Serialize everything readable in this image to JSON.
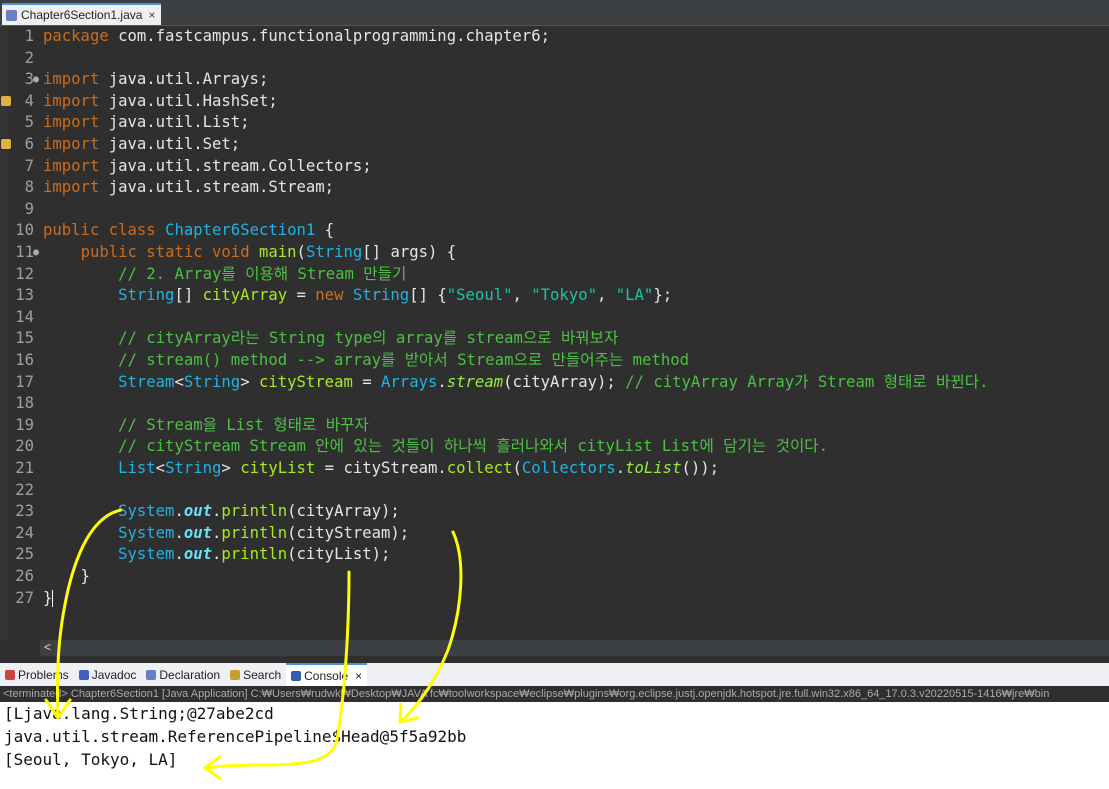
{
  "editor_tab": {
    "label": "Chapter6Section1.java",
    "close": "×"
  },
  "code_lines": [
    {
      "n": "1",
      "tokens": [
        {
          "c": "kw",
          "t": "package"
        },
        {
          "c": "",
          "t": " com.fastcampus.functionalprogramming.chapter6;"
        }
      ]
    },
    {
      "n": "2",
      "tokens": []
    },
    {
      "n": "3",
      "fold": true,
      "tokens": [
        {
          "c": "kw",
          "t": "import"
        },
        {
          "c": "",
          "t": " java.util.Arrays;"
        }
      ]
    },
    {
      "n": "4",
      "warn": true,
      "tokens": [
        {
          "c": "kw",
          "t": "import"
        },
        {
          "c": "",
          "t": " java.util.HashSet;"
        }
      ]
    },
    {
      "n": "5",
      "tokens": [
        {
          "c": "kw",
          "t": "import"
        },
        {
          "c": "",
          "t": " java.util.List;"
        }
      ]
    },
    {
      "n": "6",
      "warn": true,
      "tokens": [
        {
          "c": "kw",
          "t": "import"
        },
        {
          "c": "",
          "t": " java.util.Set;"
        }
      ]
    },
    {
      "n": "7",
      "tokens": [
        {
          "c": "kw",
          "t": "import"
        },
        {
          "c": "",
          "t": " java.util.stream.Collectors;"
        }
      ]
    },
    {
      "n": "8",
      "tokens": [
        {
          "c": "kw",
          "t": "import"
        },
        {
          "c": "",
          "t": " java.util.stream.Stream;"
        }
      ]
    },
    {
      "n": "9",
      "tokens": []
    },
    {
      "n": "10",
      "tokens": [
        {
          "c": "kw",
          "t": "public"
        },
        {
          "c": "",
          "t": " "
        },
        {
          "c": "kw",
          "t": "class"
        },
        {
          "c": "",
          "t": " "
        },
        {
          "c": "type",
          "t": "Chapter6Section1"
        },
        {
          "c": "",
          "t": " {"
        }
      ]
    },
    {
      "n": "11",
      "fold": true,
      "tokens": [
        {
          "c": "",
          "t": "    "
        },
        {
          "c": "kw",
          "t": "public"
        },
        {
          "c": "",
          "t": " "
        },
        {
          "c": "kw",
          "t": "static"
        },
        {
          "c": "",
          "t": " "
        },
        {
          "c": "kw",
          "t": "void"
        },
        {
          "c": "",
          "t": " "
        },
        {
          "c": "meth",
          "t": "main"
        },
        {
          "c": "",
          "t": "("
        },
        {
          "c": "type",
          "t": "String"
        },
        {
          "c": "",
          "t": "[] args) {"
        }
      ]
    },
    {
      "n": "12",
      "tokens": [
        {
          "c": "",
          "t": "        "
        },
        {
          "c": "cmt",
          "t": "// 2. Array를 이용해 Stream 만들기"
        }
      ]
    },
    {
      "n": "13",
      "tokens": [
        {
          "c": "",
          "t": "        "
        },
        {
          "c": "type",
          "t": "String"
        },
        {
          "c": "",
          "t": "[] "
        },
        {
          "c": "meth",
          "t": "cityArray"
        },
        {
          "c": "",
          "t": " = "
        },
        {
          "c": "kw",
          "t": "new"
        },
        {
          "c": "",
          "t": " "
        },
        {
          "c": "type",
          "t": "String"
        },
        {
          "c": "",
          "t": "[] {"
        },
        {
          "c": "str",
          "t": "\"Seoul\""
        },
        {
          "c": "",
          "t": ", "
        },
        {
          "c": "str",
          "t": "\"Tokyo\""
        },
        {
          "c": "",
          "t": ", "
        },
        {
          "c": "str",
          "t": "\"LA\""
        },
        {
          "c": "",
          "t": "};"
        }
      ]
    },
    {
      "n": "14",
      "tokens": []
    },
    {
      "n": "15",
      "tokens": [
        {
          "c": "",
          "t": "        "
        },
        {
          "c": "cmt",
          "t": "// cityArray라는 String type의 array를 stream으로 바꿔보자"
        }
      ]
    },
    {
      "n": "16",
      "tokens": [
        {
          "c": "",
          "t": "        "
        },
        {
          "c": "cmt",
          "t": "// stream() method --> array를 받아서 Stream으로 만들어주는 method"
        }
      ]
    },
    {
      "n": "17",
      "tokens": [
        {
          "c": "",
          "t": "        "
        },
        {
          "c": "type",
          "t": "Stream"
        },
        {
          "c": "",
          "t": "<"
        },
        {
          "c": "type",
          "t": "String"
        },
        {
          "c": "",
          "t": "> "
        },
        {
          "c": "meth",
          "t": "cityStream"
        },
        {
          "c": "",
          "t": " = "
        },
        {
          "c": "type",
          "t": "Arrays"
        },
        {
          "c": "",
          "t": "."
        },
        {
          "c": "smeth",
          "t": "stream"
        },
        {
          "c": "",
          "t": "(cityArray); "
        },
        {
          "c": "cmt",
          "t": "// cityArray Array가 Stream 형태로 바뀐다."
        }
      ]
    },
    {
      "n": "18",
      "tokens": []
    },
    {
      "n": "19",
      "tokens": [
        {
          "c": "",
          "t": "        "
        },
        {
          "c": "cmt",
          "t": "// Stream을 List 형태로 바꾸자"
        }
      ]
    },
    {
      "n": "20",
      "tokens": [
        {
          "c": "",
          "t": "        "
        },
        {
          "c": "cmt",
          "t": "// cityStream Stream 안에 있는 것들이 하나씩 흘러나와서 cityList List에 담기는 것이다."
        }
      ]
    },
    {
      "n": "21",
      "tokens": [
        {
          "c": "",
          "t": "        "
        },
        {
          "c": "type",
          "t": "List"
        },
        {
          "c": "",
          "t": "<"
        },
        {
          "c": "type",
          "t": "String"
        },
        {
          "c": "",
          "t": "> "
        },
        {
          "c": "meth",
          "t": "cityList"
        },
        {
          "c": "",
          "t": " = cityStream."
        },
        {
          "c": "meth",
          "t": "collect"
        },
        {
          "c": "",
          "t": "("
        },
        {
          "c": "type",
          "t": "Collectors"
        },
        {
          "c": "",
          "t": "."
        },
        {
          "c": "smeth",
          "t": "toList"
        },
        {
          "c": "",
          "t": "());"
        }
      ]
    },
    {
      "n": "22",
      "tokens": []
    },
    {
      "n": "23",
      "tokens": [
        {
          "c": "",
          "t": "        "
        },
        {
          "c": "type",
          "t": "System"
        },
        {
          "c": "",
          "t": "."
        },
        {
          "c": "fld",
          "t": "out"
        },
        {
          "c": "",
          "t": "."
        },
        {
          "c": "meth",
          "t": "println"
        },
        {
          "c": "",
          "t": "(cityArray);"
        }
      ]
    },
    {
      "n": "24",
      "tokens": [
        {
          "c": "",
          "t": "        "
        },
        {
          "c": "type",
          "t": "System"
        },
        {
          "c": "",
          "t": "."
        },
        {
          "c": "fld",
          "t": "out"
        },
        {
          "c": "",
          "t": "."
        },
        {
          "c": "meth",
          "t": "println"
        },
        {
          "c": "",
          "t": "(cityStream);"
        }
      ]
    },
    {
      "n": "25",
      "tokens": [
        {
          "c": "",
          "t": "        "
        },
        {
          "c": "type",
          "t": "System"
        },
        {
          "c": "",
          "t": "."
        },
        {
          "c": "fld",
          "t": "out"
        },
        {
          "c": "",
          "t": "."
        },
        {
          "c": "meth",
          "t": "println"
        },
        {
          "c": "",
          "t": "(cityList);"
        }
      ]
    },
    {
      "n": "26",
      "tokens": [
        {
          "c": "",
          "t": "    }"
        }
      ]
    },
    {
      "n": "27",
      "tokens": [
        {
          "c": "",
          "t": "}"
        }
      ],
      "caret": true
    }
  ],
  "hscroll": {
    "left_arrow": "<"
  },
  "panel_tabs": [
    {
      "label": "Problems",
      "icon": "problems-icon",
      "color": "#d04040",
      "active": false
    },
    {
      "label": "Javadoc",
      "icon": "javadoc-icon",
      "color": "#4060c0",
      "active": false
    },
    {
      "label": "Declaration",
      "icon": "declaration-icon",
      "color": "#6a7fc1",
      "active": false
    },
    {
      "label": "Search",
      "icon": "search-icon",
      "color": "#c8a030",
      "active": false
    },
    {
      "label": "Console",
      "icon": "console-icon",
      "color": "#3060b0",
      "active": true
    }
  ],
  "panel_close": "×",
  "console_desc": "<terminated> Chapter6Section1 [Java Application] C:₩Users₩rudwk₩Desktop₩JAVA fc₩toolworkspace₩eclipse₩plugins₩org.eclipse.justj.openjdk.hotspot.jre.full.win32.x86_64_17.0.3.v20220515-1416₩jre₩bin",
  "console_output": [
    "[Ljava.lang.String;@27abe2cd",
    "java.util.stream.ReferencePipeline$Head@5f5a92bb",
    "[Seoul, Tokyo, LA]"
  ],
  "colors": {
    "annotation": "#ffff00",
    "editor_bg": "#2f2f2f"
  }
}
